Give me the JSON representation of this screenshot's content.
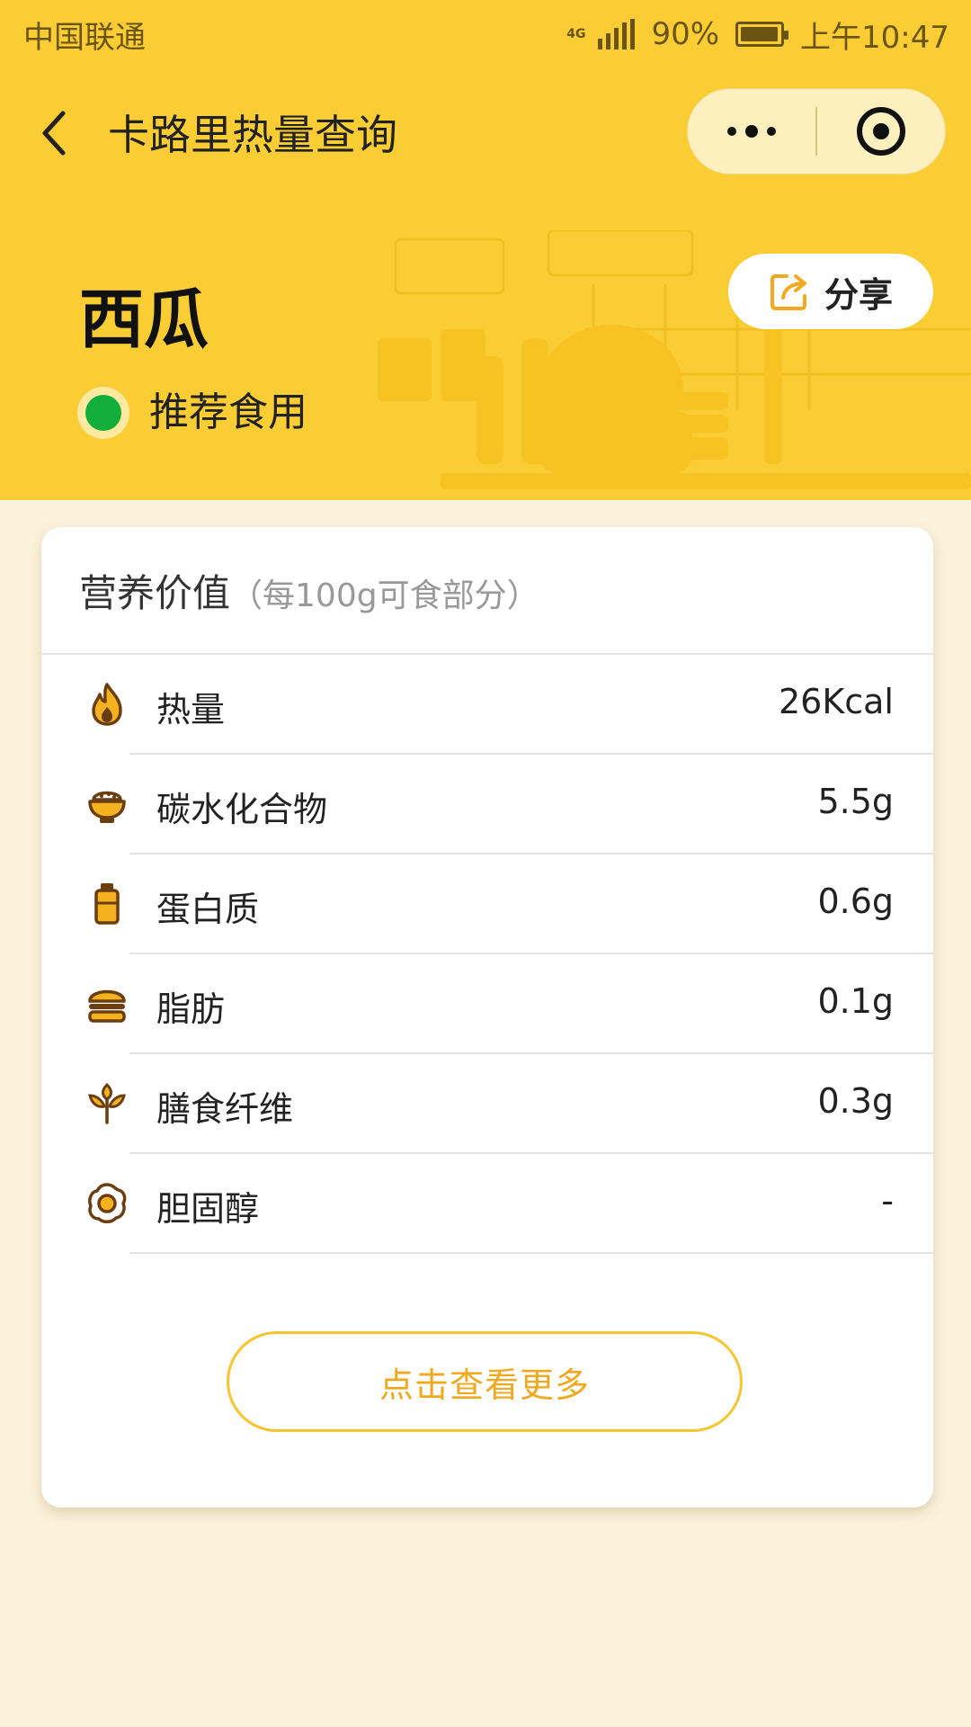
{
  "status_bar": {
    "carrier": "中国联通",
    "network": "4G",
    "battery": "90%",
    "time": "上午10:47"
  },
  "nav": {
    "title": "卡路里热量查询"
  },
  "hero": {
    "food_name": "西瓜",
    "recommendation": "推荐食用",
    "share_label": "分享"
  },
  "nutrition": {
    "title": "营养价值",
    "subtitle": "（每100g可食部分）",
    "items": [
      {
        "name": "热量",
        "value": "26Kcal",
        "icon": "flame-icon"
      },
      {
        "name": "碳水化合物",
        "value": "5.5g",
        "icon": "rice-bowl-icon"
      },
      {
        "name": "蛋白质",
        "value": "0.6g",
        "icon": "bottle-icon"
      },
      {
        "name": "脂肪",
        "value": "0.1g",
        "icon": "burger-icon"
      },
      {
        "name": "膳食纤维",
        "value": "0.3g",
        "icon": "sprout-icon"
      },
      {
        "name": "胆固醇",
        "value": "-",
        "icon": "fried-egg-icon"
      }
    ],
    "more_label": "点击查看更多"
  },
  "colors": {
    "primary": "#FBCD35",
    "page_bg": "#FBF2DC",
    "recommend_green": "#12AE3B",
    "icon_brown": "#6B3E12",
    "button_text": "#F0A81E"
  }
}
